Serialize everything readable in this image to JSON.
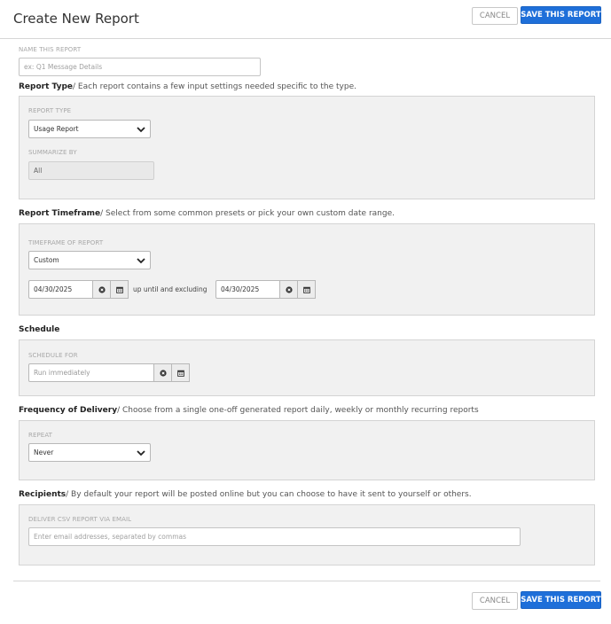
{
  "header": {
    "title": "Create New Report",
    "cancel_label": "CANCEL",
    "save_label": "SAVE THIS REPORT"
  },
  "name_field": {
    "label": "NAME THIS REPORT",
    "placeholder": "ex: Q1 Message Details"
  },
  "report_type_section": {
    "title": "Report Type",
    "description": "/ Each report contains a few input settings needed specific to the type.",
    "type_label": "REPORT TYPE",
    "type_value": "Usage Report",
    "summarize_label": "SUMMARIZE BY",
    "summarize_value": "All"
  },
  "timeframe_section": {
    "title": "Report Timeframe",
    "description": "/ Select from some common presets or pick your own custom date range.",
    "timeframe_label": "TIMEFRAME OF REPORT",
    "timeframe_value": "Custom",
    "start_date": "04/30/2025",
    "between_text": "up until and excluding",
    "end_date": "04/30/2025"
  },
  "schedule_section": {
    "title": "Schedule",
    "schedule_label": "SCHEDULE FOR",
    "schedule_placeholder": "Run immediately"
  },
  "frequency_section": {
    "title": "Frequency of Delivery",
    "description": "/ Choose from a single one-off generated report daily, weekly or monthly recurring reports",
    "repeat_label": "REPEAT",
    "repeat_value": "Never"
  },
  "recipients_section": {
    "title": "Recipients",
    "description": "/ By default your report will be posted online but you can choose to have it sent to yourself or others.",
    "email_label": "DELIVER CSV REPORT VIA EMAIL",
    "email_placeholder": "Enter email addresses, separated by commas"
  },
  "footer": {
    "cancel_label": "CANCEL",
    "save_label": "SAVE THIS REPORT"
  },
  "colors": {
    "primary_button": "#1e6fd9",
    "panel_background": "#f1f1f1"
  },
  "icons": [
    "chevron-down-icon",
    "clear-icon",
    "calendar-icon"
  ]
}
